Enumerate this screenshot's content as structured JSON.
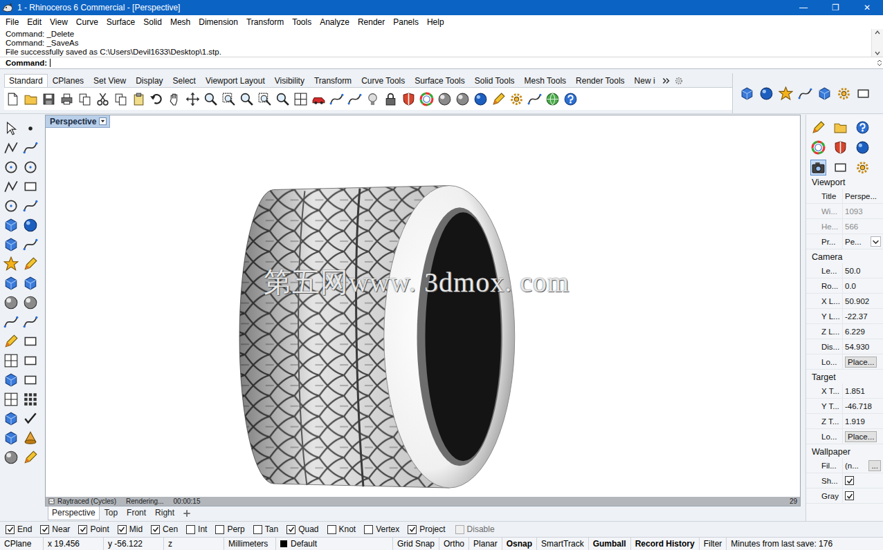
{
  "window": {
    "title": "1 - Rhinoceros 6 Commercial - [Perspective]",
    "controls": [
      "—",
      "❐",
      "✕"
    ]
  },
  "menu": [
    "File",
    "Edit",
    "View",
    "Curve",
    "Surface",
    "Solid",
    "Mesh",
    "Dimension",
    "Transform",
    "Tools",
    "Analyze",
    "Render",
    "Panels",
    "Help"
  ],
  "command_history": [
    "Command: _Delete",
    "Command: _SaveAs",
    "File successfully saved as C:\\Users\\Devil1633\\Desktop\\1.stp."
  ],
  "command_prompt": {
    "label": "Command:"
  },
  "toolbar_tabs": [
    {
      "label": "Standard",
      "selected": true
    },
    {
      "label": "CPlanes",
      "selected": false
    },
    {
      "label": "Set View",
      "selected": false
    },
    {
      "label": "Display",
      "selected": false
    },
    {
      "label": "Select",
      "selected": false
    },
    {
      "label": "Viewport Layout",
      "selected": false
    },
    {
      "label": "Visibility",
      "selected": false
    },
    {
      "label": "Transform",
      "selected": false
    },
    {
      "label": "Curve Tools",
      "selected": false
    },
    {
      "label": "Surface Tools",
      "selected": false
    },
    {
      "label": "Solid Tools",
      "selected": false
    },
    {
      "label": "Mesh Tools",
      "selected": false
    },
    {
      "label": "Render Tools",
      "selected": false
    },
    {
      "label": "New i",
      "selected": false
    }
  ],
  "viewport": {
    "title": "Perspective",
    "watermark": "第五网www. 3dmox. com",
    "display_mode": "Raytraced (Cycles)",
    "render_state": "Rendering...",
    "elapsed": "00:00:15",
    "passes": "29"
  },
  "viewport_tabs": [
    {
      "label": "Perspective",
      "selected": true
    },
    {
      "label": "Top",
      "selected": false
    },
    {
      "label": "Front",
      "selected": false
    },
    {
      "label": "Right",
      "selected": false
    }
  ],
  "osnaps": [
    {
      "label": "End",
      "checked": true,
      "disabled": false
    },
    {
      "label": "Near",
      "checked": true,
      "disabled": false
    },
    {
      "label": "Point",
      "checked": true,
      "disabled": false
    },
    {
      "label": "Mid",
      "checked": true,
      "disabled": false
    },
    {
      "label": "Cen",
      "checked": true,
      "disabled": false
    },
    {
      "label": "Int",
      "checked": false,
      "disabled": false
    },
    {
      "label": "Perp",
      "checked": false,
      "disabled": false
    },
    {
      "label": "Tan",
      "checked": false,
      "disabled": false
    },
    {
      "label": "Quad",
      "checked": true,
      "disabled": false
    },
    {
      "label": "Knot",
      "checked": false,
      "disabled": false
    },
    {
      "label": "Vertex",
      "checked": false,
      "disabled": false
    },
    {
      "label": "Project",
      "checked": true,
      "disabled": false
    },
    {
      "label": "Disable",
      "checked": false,
      "disabled": true
    }
  ],
  "properties": {
    "sections": [
      {
        "title": "Viewport",
        "rows": [
          {
            "label": "Title",
            "value": "Perspe...",
            "kind": "text",
            "disabled": false
          },
          {
            "label": "Wi...",
            "value": "1093",
            "kind": "text",
            "disabled": true
          },
          {
            "label": "He...",
            "value": "566",
            "kind": "text",
            "disabled": true
          },
          {
            "label": "Pr...",
            "value": "Pe...",
            "kind": "dropdown",
            "disabled": false
          }
        ]
      },
      {
        "title": "Camera",
        "rows": [
          {
            "label": "Le...",
            "value": "50.0",
            "kind": "text",
            "disabled": false
          },
          {
            "label": "Ro...",
            "value": "0.0",
            "kind": "text",
            "disabled": false
          },
          {
            "label": "X L...",
            "value": "50.902",
            "kind": "text",
            "disabled": false
          },
          {
            "label": "Y L...",
            "value": "-22.37",
            "kind": "text",
            "disabled": false
          },
          {
            "label": "Z L...",
            "value": "6.229",
            "kind": "text",
            "disabled": false
          },
          {
            "label": "Dis...",
            "value": "54.930",
            "kind": "text",
            "disabled": false
          },
          {
            "label": "Lo...",
            "value": "Place...",
            "kind": "button",
            "disabled": false
          }
        ]
      },
      {
        "title": "Target",
        "rows": [
          {
            "label": "X T...",
            "value": "1.851",
            "kind": "text",
            "disabled": false
          },
          {
            "label": "Y T...",
            "value": "-46.718",
            "kind": "text",
            "disabled": false
          },
          {
            "label": "Z T...",
            "value": "1.919",
            "kind": "text",
            "disabled": false
          },
          {
            "label": "Lo...",
            "value": "Place...",
            "kind": "button",
            "disabled": false
          }
        ]
      },
      {
        "title": "Wallpaper",
        "rows": [
          {
            "label": "Fil...",
            "value": "(n...",
            "button": "...",
            "kind": "file",
            "disabled": false
          },
          {
            "label": "Sh...",
            "checked": true,
            "kind": "checkbox",
            "disabled": false
          },
          {
            "label": "Gray",
            "checked": true,
            "kind": "checkbox",
            "disabled": false
          }
        ]
      }
    ]
  },
  "status_bar": [
    {
      "label": "CPlane",
      "kind": "label",
      "bold": false
    },
    {
      "label": "x 19.456",
      "kind": "coord",
      "bold": false
    },
    {
      "label": "y -56.122",
      "kind": "coord",
      "bold": false
    },
    {
      "label": "z",
      "kind": "coord",
      "bold": false
    },
    {
      "label": "Millimeters",
      "kind": "units",
      "bold": false
    },
    {
      "label": "Default",
      "kind": "layer",
      "bold": false,
      "color": "#000000"
    },
    {
      "label": "Grid Snap",
      "kind": "pane",
      "bold": false
    },
    {
      "label": "Ortho",
      "kind": "pane",
      "bold": false
    },
    {
      "label": "Planar",
      "kind": "pane",
      "bold": false
    },
    {
      "label": "Osnap",
      "kind": "pane",
      "bold": true
    },
    {
      "label": "SmartTrack",
      "kind": "pane",
      "bold": false
    },
    {
      "label": "Gumball",
      "kind": "pane",
      "bold": true
    },
    {
      "label": "Record History",
      "kind": "pane",
      "bold": true
    },
    {
      "label": "Filter",
      "kind": "pane",
      "bold": false
    },
    {
      "label": "Minutes from last save: 176",
      "kind": "info",
      "bold": false
    }
  ]
}
